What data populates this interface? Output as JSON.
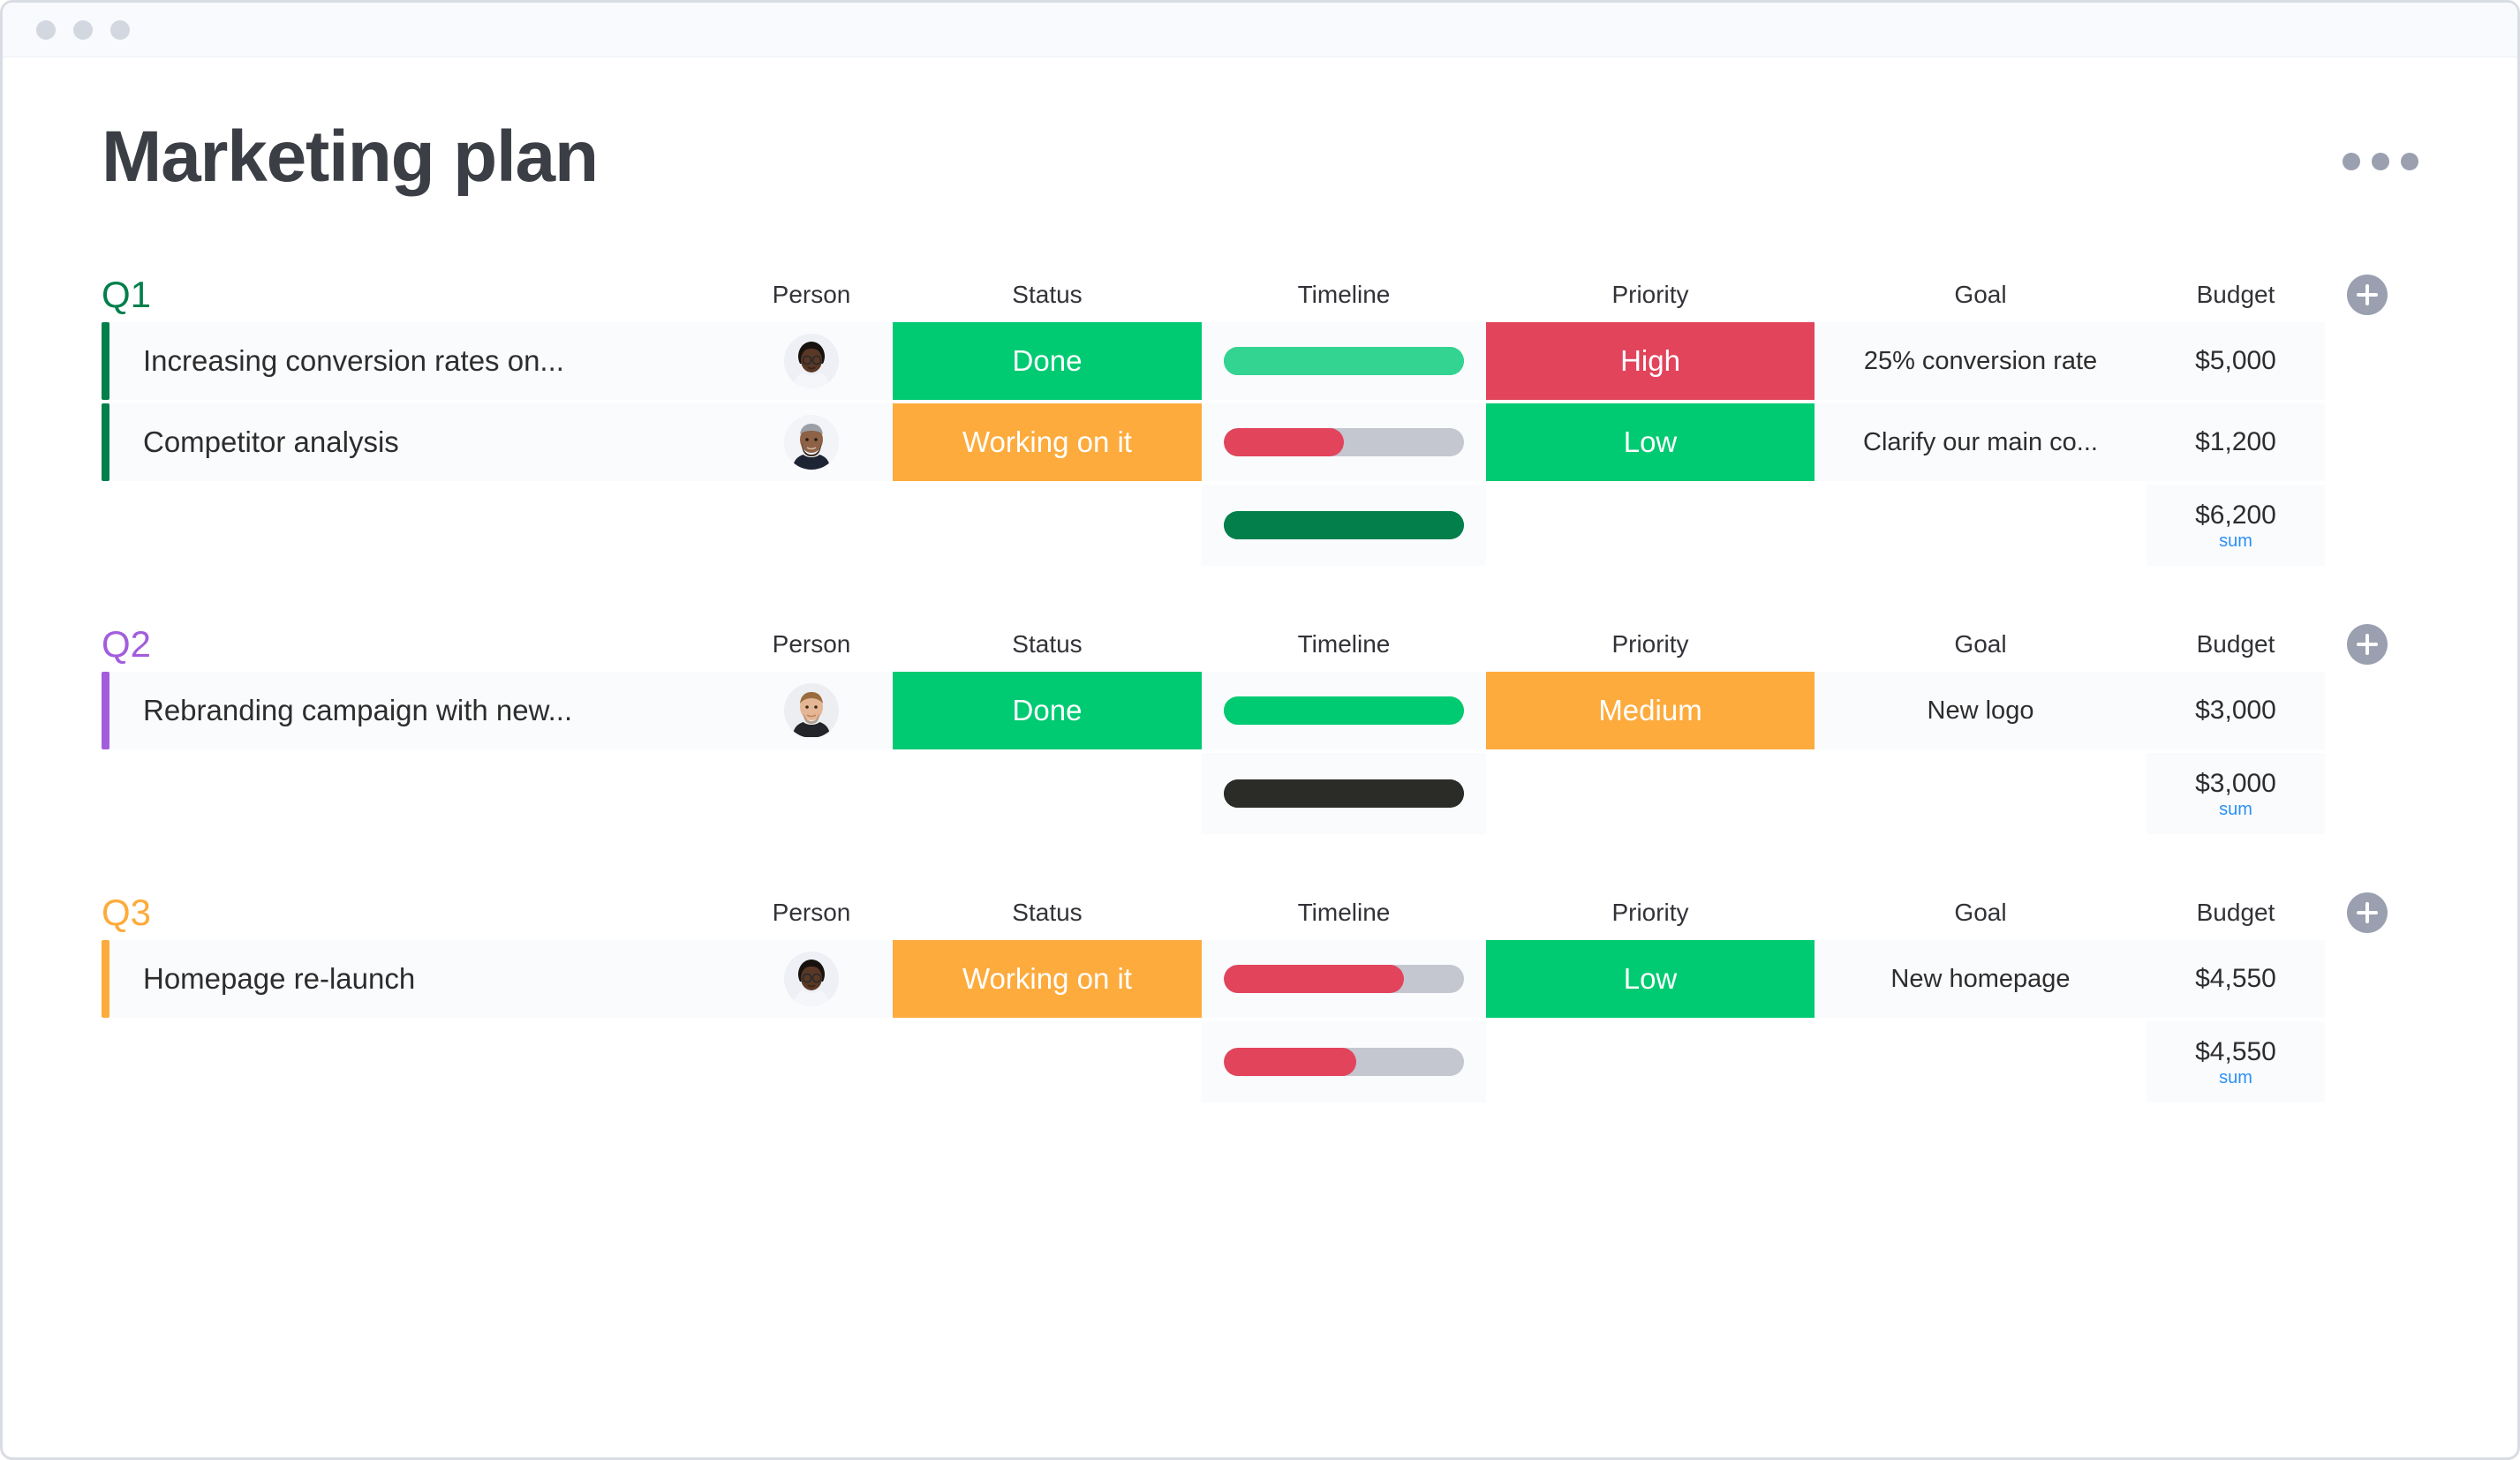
{
  "window": {
    "traffic_lights": [
      "close-dot",
      "minimize-dot",
      "maximize-dot"
    ]
  },
  "header": {
    "title": "Marketing plan",
    "more_menu": "•••"
  },
  "columns": [
    "Person",
    "Status",
    "Timeline",
    "Priority",
    "Goal",
    "Budget"
  ],
  "colors": {
    "green": "#00ca72",
    "dark_green": "#037f4c",
    "yellow": "#fdab3d",
    "red": "#e2445c",
    "purple": "#a25ddc",
    "grey_track": "#c5c7d0",
    "dark": "#2b2b28",
    "sum_link": "#2b8ff5",
    "row_bg": "#fafbfd"
  },
  "groups": [
    {
      "name": "Q1",
      "color": "#037f4c",
      "add_label": "+",
      "items": [
        {
          "name": "Increasing conversion rates on...",
          "person": "avatar-woman-glasses",
          "status": {
            "label": "Done",
            "color": "#00ca72"
          },
          "timeline": {
            "progress": 100,
            "fill": "#33d391",
            "track": "#00ca72"
          },
          "priority": {
            "label": "High",
            "color": "#e2445c"
          },
          "goal": "25% conversion rate",
          "budget": "$5,000"
        },
        {
          "name": "Competitor analysis",
          "person": "avatar-man-beard",
          "status": {
            "label": "Working on it",
            "color": "#fdab3d"
          },
          "timeline": {
            "progress": 50,
            "fill": "#e2445c",
            "track": "#c5c7d0"
          },
          "priority": {
            "label": "Low",
            "color": "#00ca72"
          },
          "goal": "Clarify our main co...",
          "budget": "$1,200"
        }
      ],
      "summary": {
        "timeline": {
          "progress": 100,
          "fill": "#037f4c",
          "track": "#037f4c"
        },
        "budget_value": "$6,200",
        "budget_label": "sum"
      }
    },
    {
      "name": "Q2",
      "color": "#a25ddc",
      "add_label": "+",
      "items": [
        {
          "name": "Rebranding campaign with new...",
          "person": "avatar-man-light",
          "status": {
            "label": "Done",
            "color": "#00ca72"
          },
          "timeline": {
            "progress": 100,
            "fill": "#00ca72",
            "track": "#00ca72"
          },
          "priority": {
            "label": "Medium",
            "color": "#fdab3d"
          },
          "goal": "New logo",
          "budget": "$3,000"
        }
      ],
      "summary": {
        "timeline": {
          "progress": 100,
          "fill": "#2b2b28",
          "track": "#2b2b28"
        },
        "budget_value": "$3,000",
        "budget_label": "sum"
      }
    },
    {
      "name": "Q3",
      "color": "#fdab3d",
      "add_label": "+",
      "items": [
        {
          "name": "Homepage re-launch",
          "person": "avatar-woman-glasses",
          "status": {
            "label": "Working on it",
            "color": "#fdab3d"
          },
          "timeline": {
            "progress": 75,
            "fill": "#e2445c",
            "track": "#c5c7d0"
          },
          "priority": {
            "label": "Low",
            "color": "#00ca72"
          },
          "goal": "New homepage",
          "budget": "$4,550"
        }
      ],
      "summary": {
        "timeline": {
          "progress": 55,
          "fill": "#e2445c",
          "track": "#c5c7d0"
        },
        "budget_value": "$4,550",
        "budget_label": "sum"
      }
    }
  ]
}
